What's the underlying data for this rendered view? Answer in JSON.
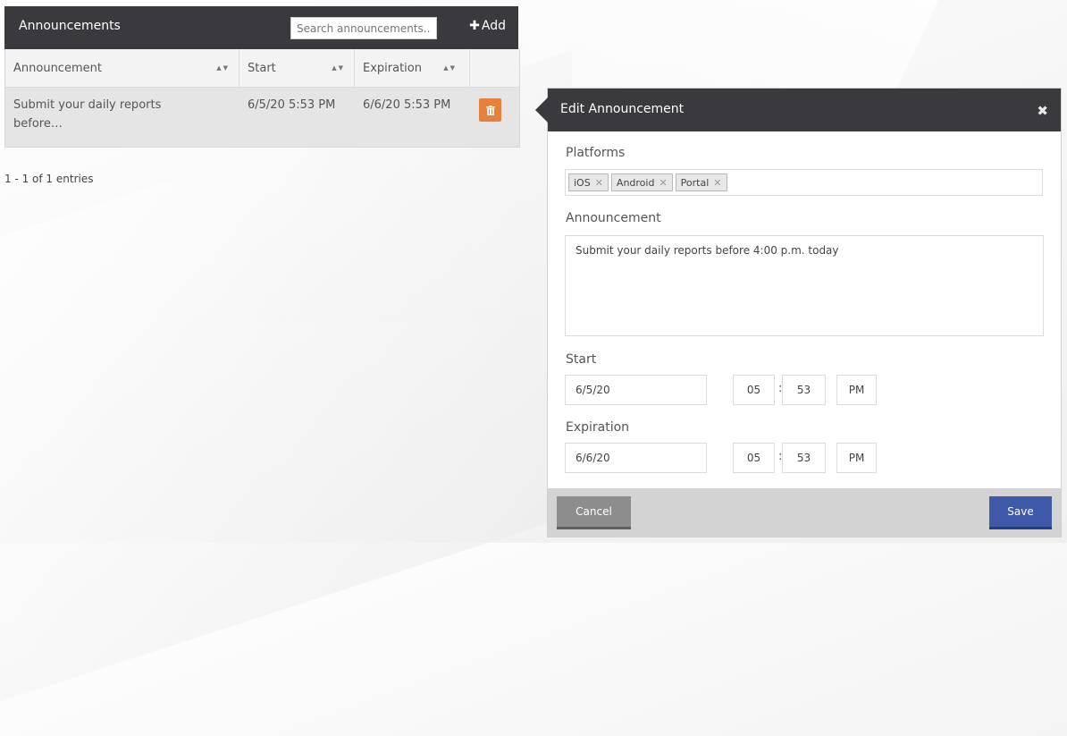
{
  "list": {
    "title": "Announcements",
    "search_placeholder": "Search announcements...",
    "add_label": "Add",
    "columns": [
      "Announcement",
      "Start",
      "Expiration"
    ],
    "rows": [
      {
        "announcement": "Submit your daily reports before…",
        "start": "6/5/20 5:53 PM",
        "expiration": "6/6/20 5:53 PM"
      }
    ],
    "entries_text": "1 - 1 of 1 entries"
  },
  "edit": {
    "title": "Edit Announcement",
    "platforms_label": "Platforms",
    "platforms": [
      "iOS",
      "Android",
      "Portal"
    ],
    "announcement_label": "Announcement",
    "announcement_text": "Submit your daily reports before 4:00 p.m. today",
    "start_label": "Start",
    "start": {
      "date": "6/5/20",
      "hour": "05",
      "minute": "53",
      "ampm": "PM"
    },
    "expiration_label": "Expiration",
    "expiration": {
      "date": "6/6/20",
      "hour": "05",
      "minute": "53",
      "ampm": "PM"
    },
    "cancel_label": "Cancel",
    "save_label": "Save"
  },
  "colors": {
    "header_bg": "#3a3a3e",
    "delete": "#e8803d",
    "save": "#3f58a8",
    "cancel": "#8d8d8d"
  }
}
